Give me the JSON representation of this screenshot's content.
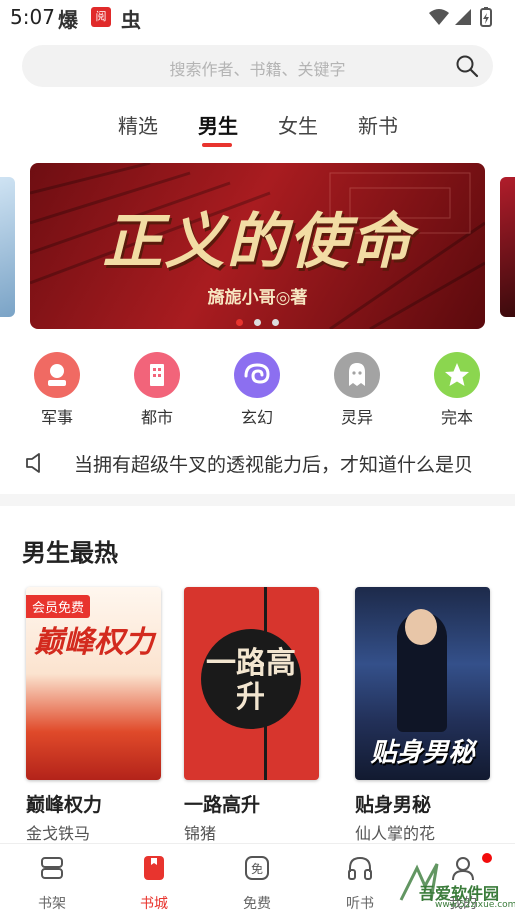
{
  "status": {
    "time": "5:07",
    "badges": [
      "爆",
      "阅",
      "虫"
    ]
  },
  "search": {
    "placeholder": "搜索作者、书籍、关键字"
  },
  "tabs": [
    {
      "label": "精选",
      "active": false
    },
    {
      "label": "男生",
      "active": true
    },
    {
      "label": "女生",
      "active": false
    },
    {
      "label": "新书",
      "active": false
    }
  ],
  "banner": {
    "title": "正义的使命",
    "subtitle": "旖旎小哥◎著",
    "dots": 3,
    "active_dot": 0
  },
  "categories": [
    {
      "label": "军事",
      "icon": "medal-icon",
      "color": "#f06a63"
    },
    {
      "label": "都市",
      "icon": "building-icon",
      "color": "#f2647a"
    },
    {
      "label": "玄幻",
      "icon": "swirl-icon",
      "color": "#8c6ff0"
    },
    {
      "label": "灵异",
      "icon": "ghost-icon",
      "color": "#a3a3a3"
    },
    {
      "label": "完本",
      "icon": "star-icon",
      "color": "#8bd64f"
    }
  ],
  "notice": {
    "text": "当拥有超级牛叉的透视能力后，才知道什么是贝"
  },
  "section": {
    "title": "男生最热"
  },
  "books": [
    {
      "title": "巅峰权力",
      "author": "金戈铁马",
      "tag": "会员免费",
      "cover_text": "巅峰权力"
    },
    {
      "title": "一路高升",
      "author": "锦猪",
      "tag": "",
      "cover_text": "一路高升"
    },
    {
      "title": "贴身男秘",
      "author": "仙人掌的花",
      "tag": "",
      "cover_text": "贴身男秘"
    }
  ],
  "nav": [
    {
      "label": "书架",
      "icon": "bookshelf-icon",
      "active": false
    },
    {
      "label": "书城",
      "icon": "bookstore-icon",
      "active": true
    },
    {
      "label": "免费",
      "icon": "free-icon",
      "active": false
    },
    {
      "label": "听书",
      "icon": "headphones-icon",
      "active": false
    },
    {
      "label": "我的",
      "icon": "profile-icon",
      "active": false
    }
  ],
  "colors": {
    "accent": "#e8342e",
    "search_bg": "#f2f2f2"
  },
  "watermark": {
    "text": "吾爱软件园",
    "url": "www.52zixue.com"
  }
}
